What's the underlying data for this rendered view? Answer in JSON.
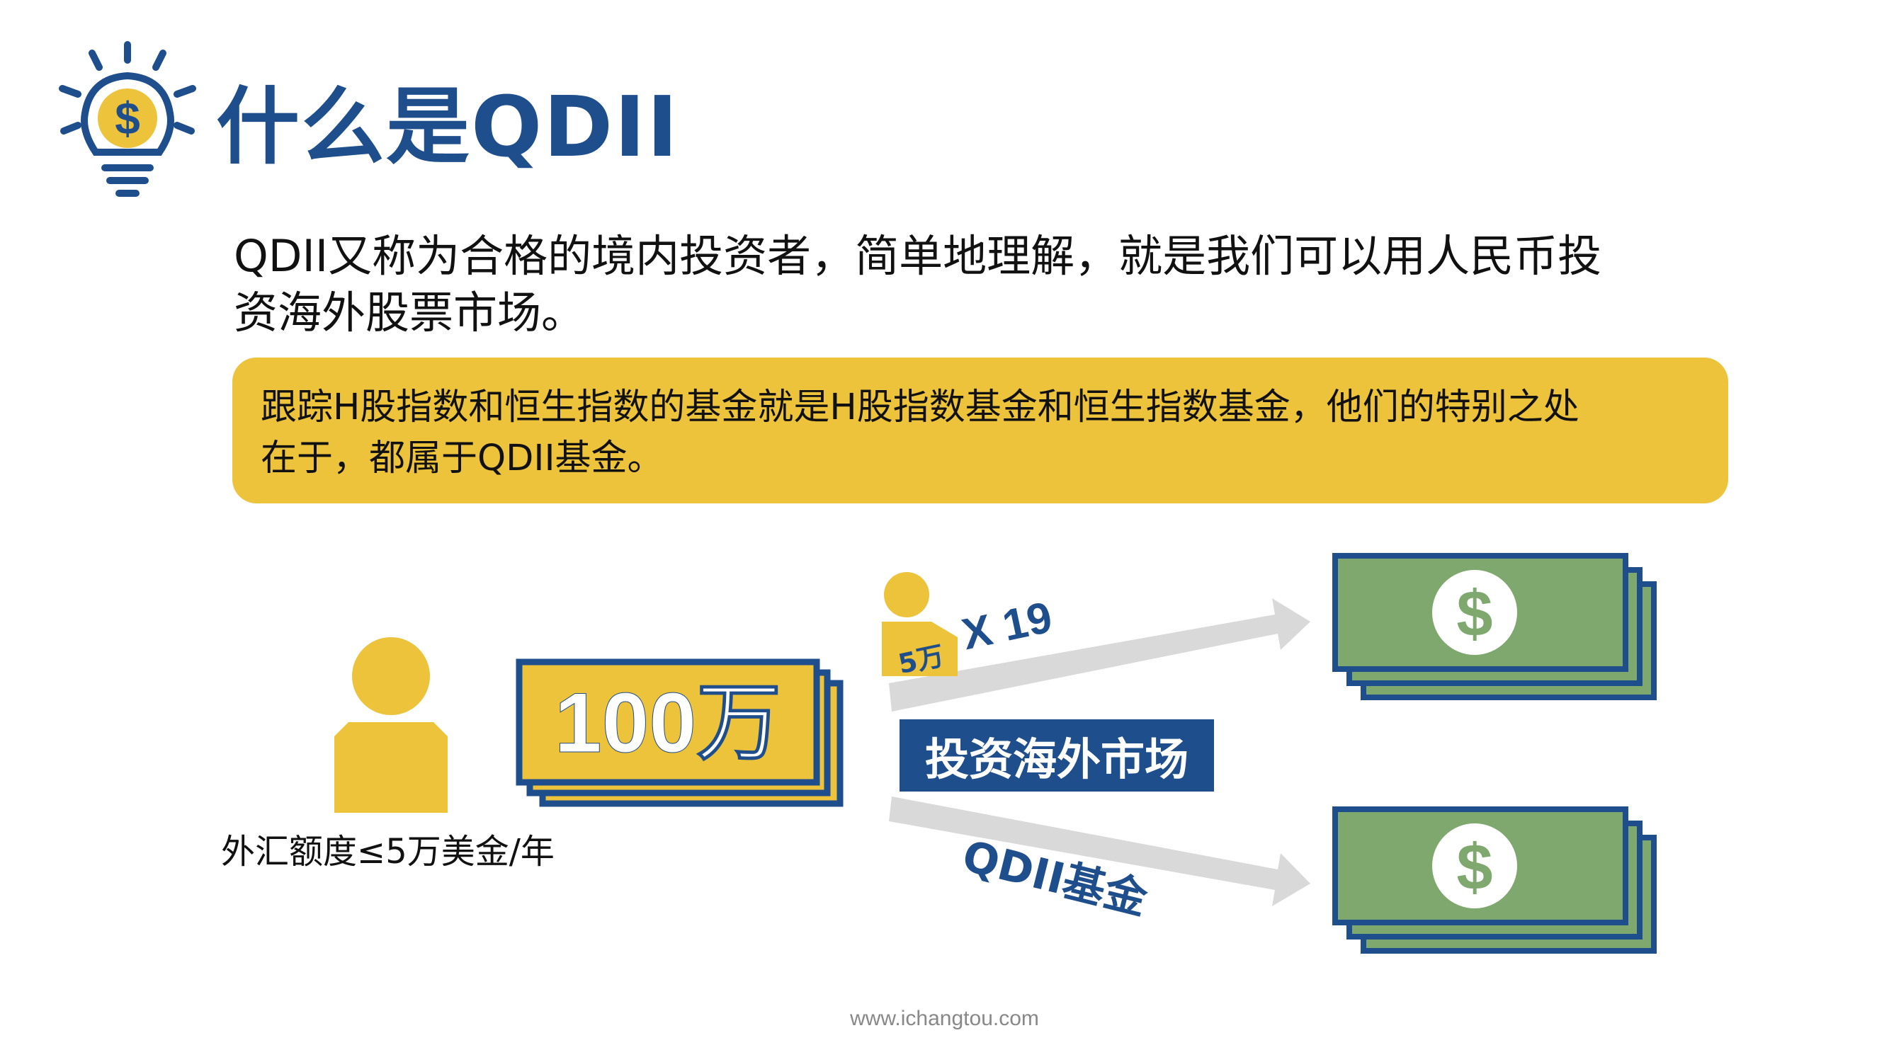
{
  "header": {
    "title": "什么是QDII",
    "icon": "lightbulb-dollar-icon"
  },
  "intro": {
    "line1": "QDII又称为合格的境内投资者，简单地理解，就是我们可以用人民币投",
    "line2": "资海外股票市场。"
  },
  "callout": {
    "line1": "跟踪H股指数和恒生指数的基金就是H股指数基金和恒生指数基金，他们的特别之处",
    "line2": "在于，都属于QDII基金。"
  },
  "diagram": {
    "person_caption": "外汇额度≤5万美金/年",
    "bill_amount": "100万",
    "small_person_badge": "5万",
    "multiplier": "X 19",
    "center_badge": "投资海外市场",
    "lower_label": "QDII基金",
    "dollar_symbol": "$"
  },
  "footer": {
    "url": "www.ichangtou.com"
  },
  "colors": {
    "navy": "#1f4e8c",
    "yellow": "#ecc33a",
    "green": "#7fa86f",
    "arrow_gray": "#d9d9d9"
  }
}
